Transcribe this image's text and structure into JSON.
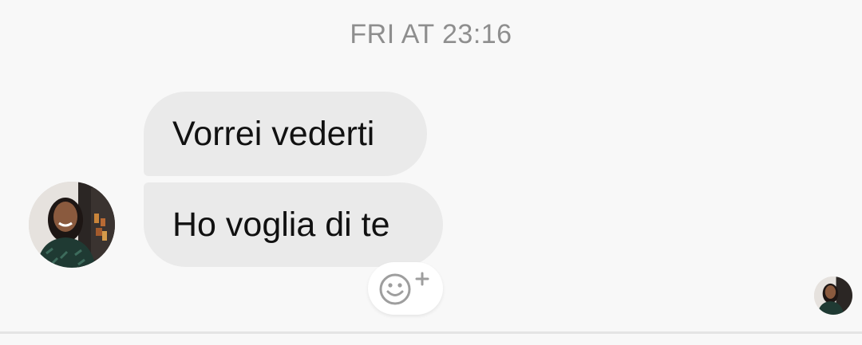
{
  "thread": {
    "timestamp": "FRI AT 23:16",
    "messages": [
      {
        "text": "Vorrei vederti"
      },
      {
        "text": "Ho voglia di te"
      }
    ]
  },
  "icons": {
    "avatar": "contact-avatar",
    "reaction": "add-reaction-icon",
    "seen": "read-receipt-avatar"
  },
  "colors": {
    "background": "#f8f8f8",
    "bubble": "#eaeaea",
    "timestamp": "#8e8e8e",
    "text": "#111111"
  }
}
